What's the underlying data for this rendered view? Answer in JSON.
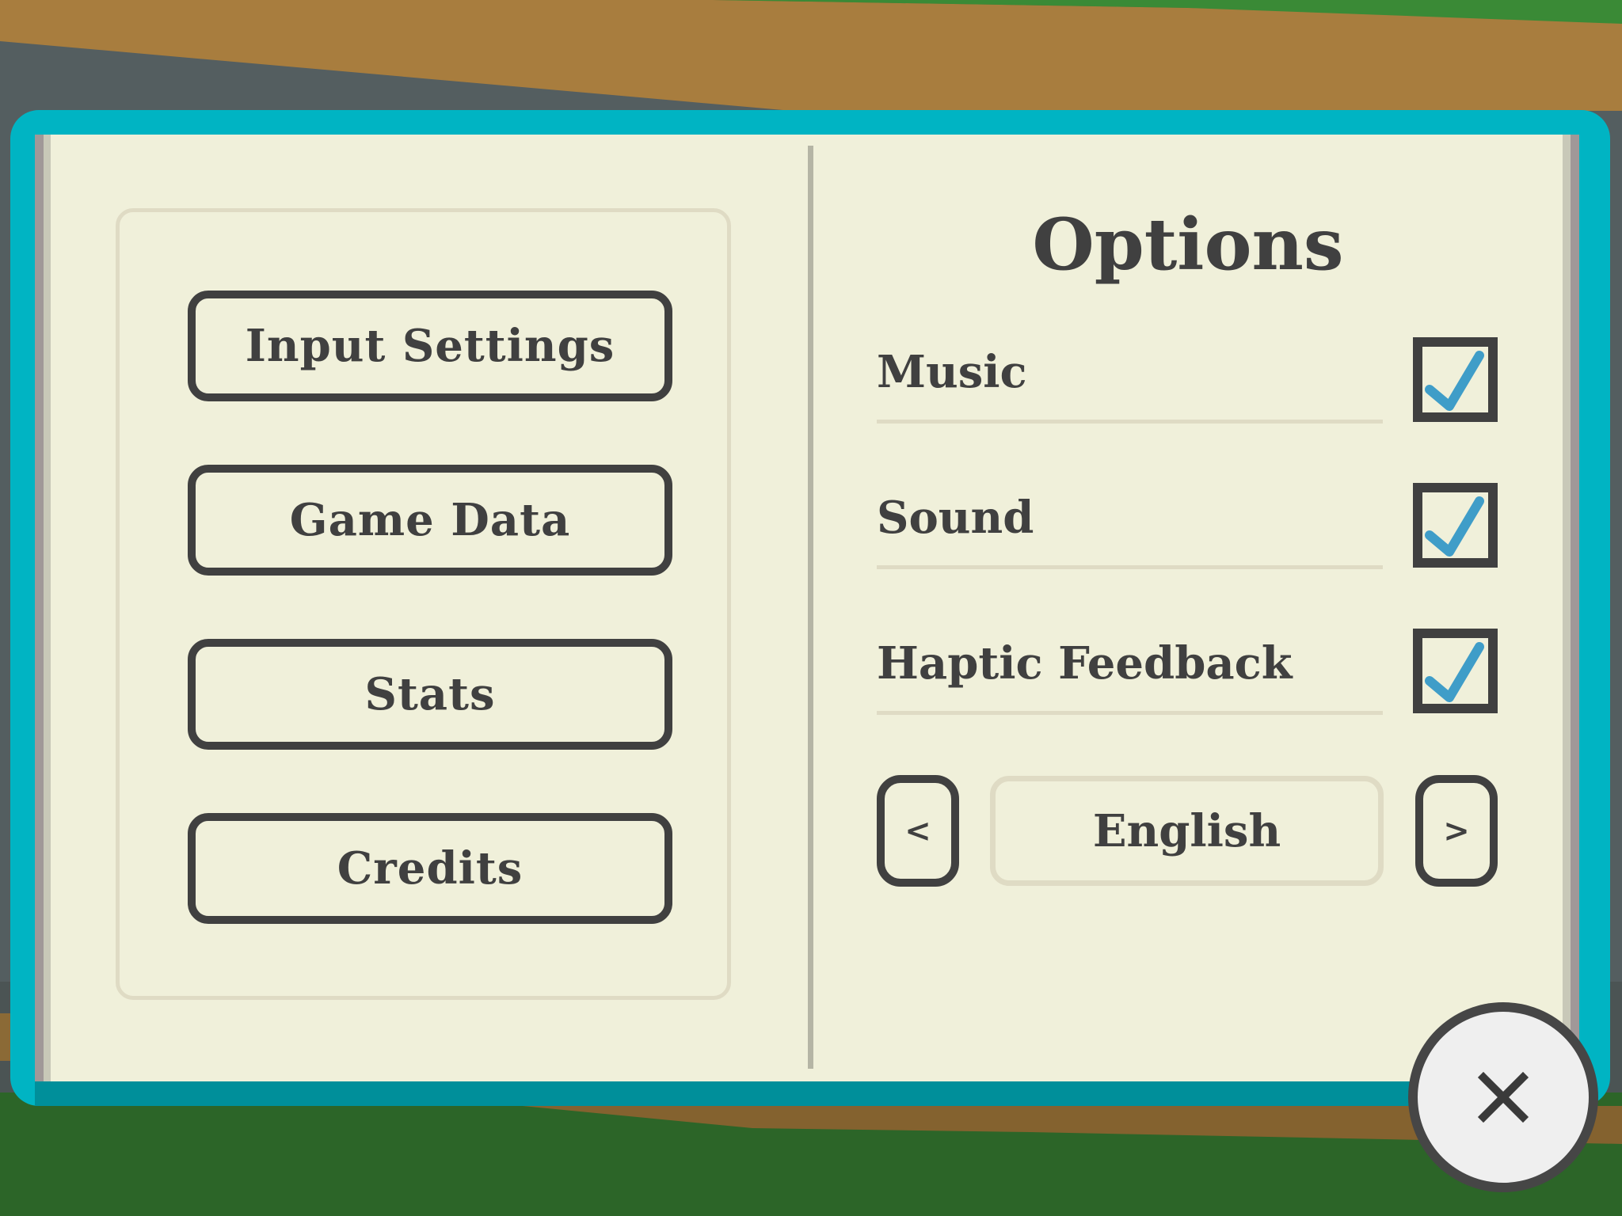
{
  "menu": {
    "buttons": [
      {
        "label": "Input Settings"
      },
      {
        "label": "Game Data"
      },
      {
        "label": "Stats"
      },
      {
        "label": "Credits"
      }
    ]
  },
  "options": {
    "title": "Options",
    "toggles": [
      {
        "label": "Music",
        "checked": true
      },
      {
        "label": "Sound",
        "checked": true
      },
      {
        "label": "Haptic Feedback",
        "checked": true
      }
    ],
    "language": {
      "prev_label": "<",
      "value": "English",
      "next_label": ">"
    }
  },
  "close": {
    "icon": "close-icon"
  },
  "colors": {
    "book_cover": "#00b4c3",
    "page": "#f0f0da",
    "text": "#404040",
    "checkmark": "#3f9dc8"
  }
}
